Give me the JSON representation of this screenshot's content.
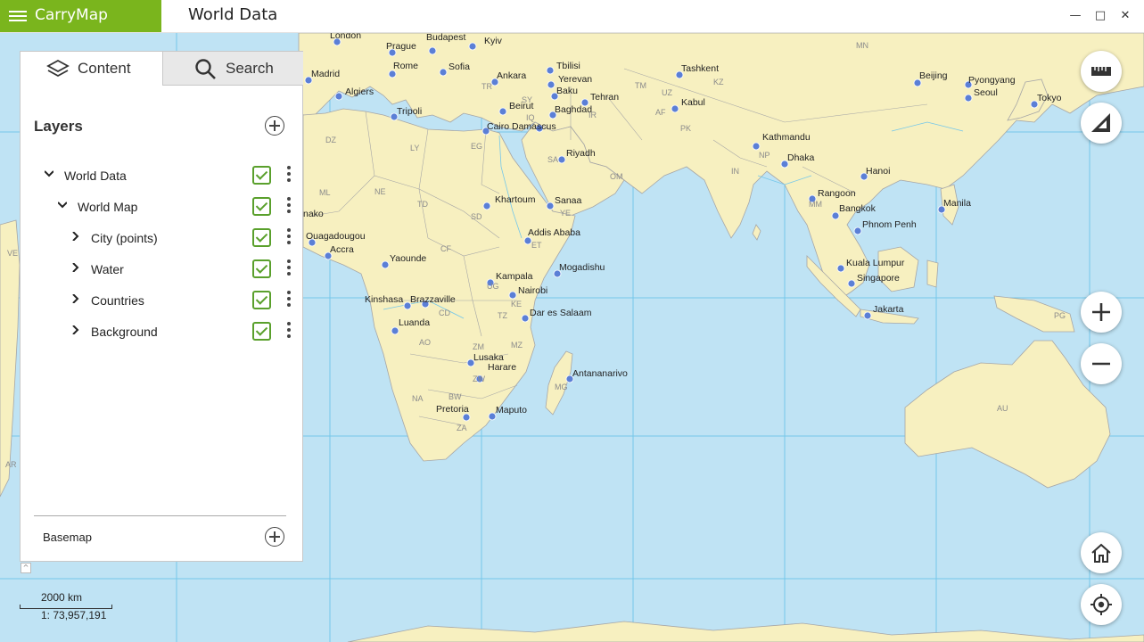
{
  "app": {
    "name": "CarryMap",
    "document_title": "World Data"
  },
  "window_controls": {
    "minimize": "—",
    "maximize": "□",
    "close": "✕"
  },
  "panel": {
    "tabs": [
      {
        "label": "Content",
        "icon": "layers-icon",
        "active": true
      },
      {
        "label": "Search",
        "icon": "search-icon",
        "active": false
      }
    ],
    "layers_title": "Layers",
    "layers": [
      {
        "label": "World Data",
        "expanded": true,
        "checked": true
      },
      {
        "label": "World Map",
        "expanded": true,
        "checked": true
      },
      {
        "label": "City (points)",
        "expanded": false,
        "checked": true
      },
      {
        "label": "Water",
        "expanded": false,
        "checked": true
      },
      {
        "label": "Countries",
        "expanded": false,
        "checked": true
      },
      {
        "label": "Background",
        "expanded": false,
        "checked": true
      }
    ],
    "basemap_label": "Basemap"
  },
  "map": {
    "cities": [
      "London",
      "Prague",
      "Budapest",
      "Kyiv",
      "Madrid",
      "Rome",
      "Sofia",
      "Ankara",
      "Tbilisi",
      "Yerevan",
      "Baku",
      "Tashkent",
      "Algiers",
      "Tripoli",
      "Beirut",
      "Tehran",
      "Baghdad",
      "Kabul",
      "Cairo",
      "Damascus",
      "Kathmandu",
      "Beijing",
      "Pyongyang",
      "Seoul",
      "Tokyo",
      "Riyadh",
      "Dhaka",
      "Hanoi",
      "Khartoum",
      "Sanaa",
      "Rangoon",
      "Bangkok",
      "Manila",
      "Ouagadougou",
      "Accra",
      "Addis Ababa",
      "Phnom Penh",
      "Yaounde",
      "Mogadishu",
      "Kuala Lumpur",
      "Kampala",
      "Singapore",
      "Nairobi",
      "Kinshasa",
      "Brazzaville",
      "Dar es Salaam",
      "Jakarta",
      "Luanda",
      "Antananarivo",
      "Lusaka",
      "Harare",
      "Pretoria",
      "Maputo",
      "nako"
    ],
    "country_codes": [
      "MN",
      "DZ",
      "LY",
      "EG",
      "SA",
      "IN",
      "OM",
      "NE",
      "TD",
      "SD",
      "ML",
      "CF",
      "CD",
      "KE",
      "TZ",
      "AO",
      "ZM",
      "MZ",
      "BW",
      "NA",
      "ZA",
      "ZW",
      "MG",
      "ET",
      "UG",
      "YE",
      "MM",
      "TR",
      "SY",
      "IQ",
      "IR",
      "AF",
      "PK",
      "NP",
      "TM",
      "UZ",
      "KZ",
      "AU",
      "PG",
      "VE",
      "AR"
    ]
  },
  "scale": {
    "distance": "2000 km",
    "ratio": "1: 73,957,191"
  },
  "colors": {
    "brand": "#7ab51d",
    "water": "#bfe3f4",
    "land": "#f7f0c0",
    "checkbox": "#5aa02c",
    "annotation_arrow": "#e8402a"
  }
}
